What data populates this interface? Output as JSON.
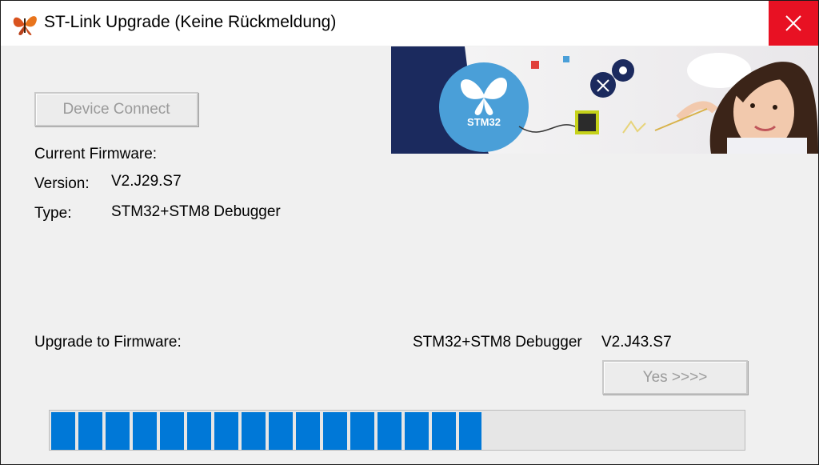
{
  "window": {
    "title": "ST-Link Upgrade (Keine Rückmeldung)",
    "app_icon": "butterfly-icon",
    "close_icon": "close-icon",
    "close_color": "#e81123"
  },
  "main": {
    "device_connect_label": "Device Connect",
    "current_firmware_label": "Current Firmware:",
    "version_label": "Version:",
    "version_value": "V2.J29.S7",
    "type_label": "Type:",
    "type_value": "STM32+STM8 Debugger",
    "upgrade_label": "Upgrade to Firmware:",
    "upgrade_type": "STM32+STM8 Debugger",
    "upgrade_version": "V2.J43.S7",
    "yes_label": "Yes >>>>"
  },
  "banner": {
    "logo_text": "STM32"
  },
  "progress": {
    "percent": 62,
    "color": "#0078d7"
  }
}
